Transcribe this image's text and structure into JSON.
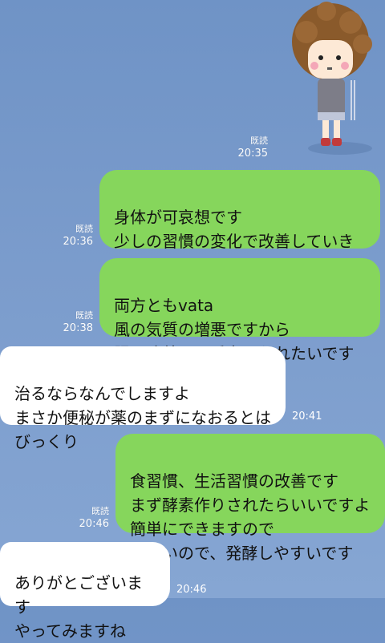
{
  "messages": [
    {
      "id": "m1",
      "side": "right",
      "type": "sticker",
      "read": "既読",
      "time": "20:35",
      "sticker_name": "girl-sticker"
    },
    {
      "id": "m2",
      "side": "right",
      "read": "既読",
      "time": "20:36",
      "text": "身体が可哀想です\n少しの習慣の変化で改善していきま\nす",
      "emoji": "❣️"
    },
    {
      "id": "m3",
      "side": "right",
      "read": "既読",
      "time": "20:38",
      "text": "両方ともvata\n風の気質の増悪ですから\n腸の改善に一番力を入れたいですね"
    },
    {
      "id": "m4",
      "side": "left",
      "time": "20:41",
      "text": "治るならなんでしますよ\nまさか便秘が薬のまずになおるとは\nびっくり"
    },
    {
      "id": "m5",
      "side": "right",
      "read": "既読",
      "time": "20:46",
      "text": "食習慣、生活習慣の改善です\nまず酵素作りされたらいいですよ\n簡単にできますので\n今暑いので、発酵しやすいです"
    },
    {
      "id": "m6",
      "side": "left",
      "time": "20:46",
      "text": "ありがとございます\nやってみますね"
    }
  ],
  "colors": {
    "sent_bubble": "#86d65c",
    "received_bubble": "#ffffff",
    "background": "#7b9ccc"
  }
}
